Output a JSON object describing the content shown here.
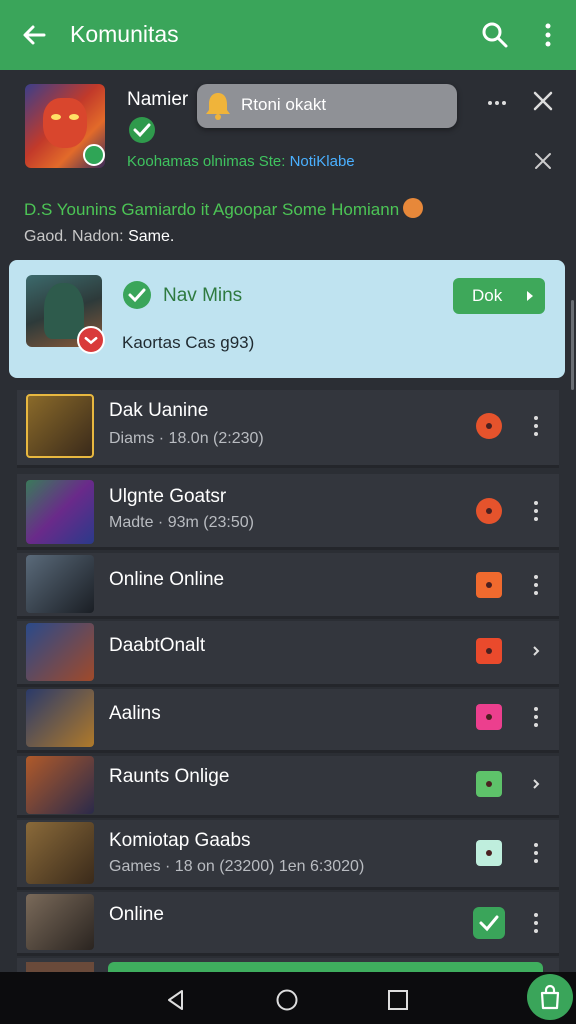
{
  "app_bar": {
    "title": "Komunitas",
    "icons": [
      "back-arrow-icon",
      "search-icon",
      "more-vertical-icon"
    ]
  },
  "notification": {
    "name": "Namier",
    "pill_text": "Rtoni okakt",
    "subtitle": "Koohamas olnimas Ste: ",
    "subtitle_highlight": "NotiKlabe",
    "colors": {
      "green": "#3aa55a",
      "link": "#4ab0ff"
    }
  },
  "description": {
    "line1": "D.S Younins Gamiardo it Agoopar Some Homiann",
    "line2_prefix": "Gaod. Nadon: ",
    "line2_strong": "Same."
  },
  "featured": {
    "title": "Nav Mins",
    "subtitle": "Kaortas Cas g93)",
    "button_label": "Dok"
  },
  "list": [
    {
      "name": "Dak Uanine",
      "meta": "Diams · 18.0n (2:230)",
      "status_color": "#e5532c",
      "status_shape": "round"
    },
    {
      "name": "Ulgnte Goatsr",
      "meta": "Madte · 93m (23:50)",
      "status_color": "#e5532c",
      "status_shape": "round"
    },
    {
      "name": "Online Online",
      "meta": "",
      "status_color": "#f06a2e",
      "status_shape": "square"
    },
    {
      "name": "DaabtOnalt",
      "meta": "",
      "status_color": "#ea4a2c",
      "status_shape": "square"
    },
    {
      "name": "Aalins",
      "meta": "",
      "status_color": "#ec3f8e",
      "status_shape": "square"
    },
    {
      "name": "Raunts Onlige",
      "meta": "",
      "status_color": "#5ec26a",
      "status_shape": "square"
    },
    {
      "name": "Komiotap Gaabs",
      "meta": "Games · 18 on (23200)   1en 6:3020)",
      "status_color": "#bfeedd",
      "status_shape": "square"
    },
    {
      "name": "Online",
      "meta": "",
      "status_color": "#3aa55a",
      "status_shape": "check"
    }
  ],
  "nav_bar": {
    "icons": [
      "back-triangle-icon",
      "home-circle-icon",
      "recents-square-icon"
    ]
  },
  "fab": {
    "icon": "shopping-bag-icon"
  }
}
